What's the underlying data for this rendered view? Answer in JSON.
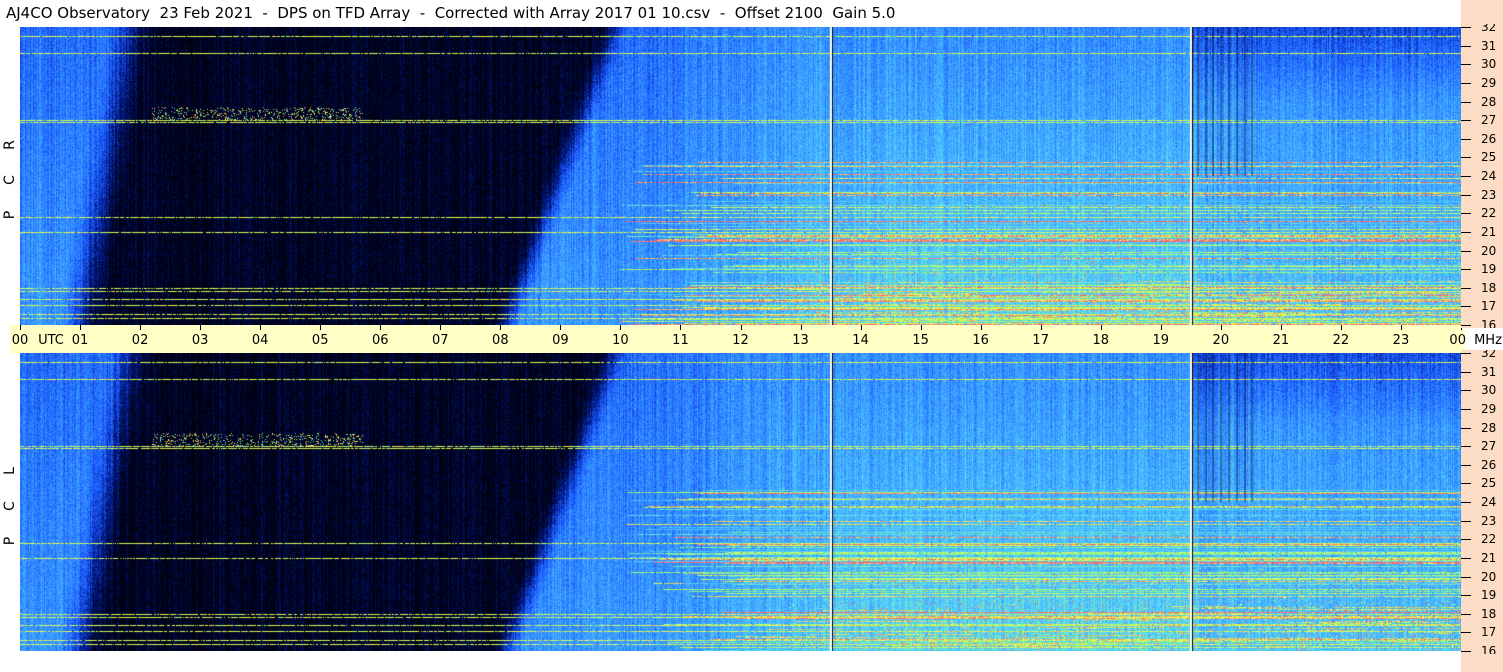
{
  "title": "AJ4CO Observatory  23 Feb 2021  -  DPS on TFD Array  -  Corrected with Array 2017 01 10.csv  -  Offset 2100  Gain 5.0",
  "chart_data": [
    {
      "type": "heatmap",
      "panel": "RCP",
      "ylabel_letters": [
        "R",
        "C",
        "P"
      ],
      "x_ticks": [
        "00",
        "01",
        "02",
        "03",
        "04",
        "05",
        "06",
        "07",
        "08",
        "09",
        "10",
        "11",
        "12",
        "13",
        "14",
        "15",
        "16",
        "17",
        "18",
        "19",
        "20",
        "21",
        "22",
        "23",
        "00"
      ],
      "x_unit": "UTC",
      "xlim_hours": [
        0,
        24
      ],
      "y_ticks": [
        32,
        31,
        30,
        29,
        28,
        27,
        26,
        25,
        24,
        23,
        22,
        21,
        20,
        19,
        18,
        17,
        16
      ],
      "y_unit": "MHz",
      "ylim_mhz": [
        16,
        32
      ],
      "colormap": [
        "#000010",
        "#00167a",
        "#1a58ff",
        "#3a9cff",
        "#55d6ff",
        "#9dff6a",
        "#ffff40",
        "#ff6070"
      ],
      "vertical_markers_hours": [
        13.5,
        19.5
      ],
      "night_dark_interval_hours": [
        2.3,
        9.6
      ]
    },
    {
      "type": "heatmap",
      "panel": "LCP",
      "ylabel_letters": [
        "L",
        "C",
        "P"
      ],
      "x_ticks": [
        "00",
        "01",
        "02",
        "03",
        "04",
        "05",
        "06",
        "07",
        "08",
        "09",
        "10",
        "11",
        "12",
        "13",
        "14",
        "15",
        "16",
        "17",
        "18",
        "19",
        "20",
        "21",
        "22",
        "23",
        "00"
      ],
      "x_unit": "UTC",
      "xlim_hours": [
        0,
        24
      ],
      "y_ticks": [
        32,
        31,
        30,
        29,
        28,
        27,
        26,
        25,
        24,
        23,
        22,
        21,
        20,
        19,
        18,
        17,
        16
      ],
      "y_unit": "MHz",
      "ylim_mhz": [
        16,
        32
      ],
      "colormap": [
        "#000010",
        "#00167a",
        "#1a58ff",
        "#3a9cff",
        "#55d6ff",
        "#9dff6a",
        "#ffff40",
        "#ff6070"
      ],
      "vertical_markers_hours": [
        13.5,
        19.5
      ],
      "night_dark_interval_hours": [
        2.3,
        9.6
      ]
    }
  ],
  "axis": {
    "utc_label": "UTC",
    "mhz_label": "MHz"
  }
}
